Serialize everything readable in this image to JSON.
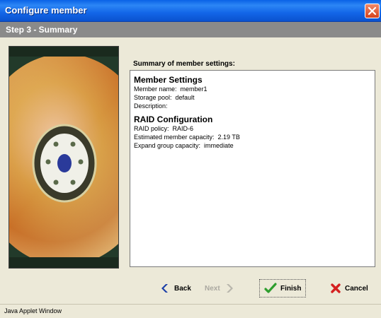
{
  "window": {
    "title": "Configure member"
  },
  "step": {
    "title": "Step 3 - Summary"
  },
  "summary": {
    "label": "Summary of member settings:",
    "member_settings": {
      "heading": "Member Settings",
      "rows": [
        "Member name:  member1",
        "Storage pool:  default",
        "Description:"
      ]
    },
    "raid": {
      "heading": "RAID Configuration",
      "rows": [
        "RAID policy:  RAID-6",
        "Estimated member capacity:  2.19 TB",
        "Expand group capacity:  immediate"
      ]
    }
  },
  "buttons": {
    "back": "Back",
    "next": "Next",
    "finish": "Finish",
    "cancel": "Cancel"
  },
  "status_bar": {
    "text": "Java Applet Window"
  },
  "icons": {
    "close": "close-icon",
    "back": "back-arrow-icon",
    "next": "next-arrow-icon",
    "finish": "checkmark-icon",
    "cancel": "cross-icon",
    "disk": "hard-disk-image"
  },
  "colors": {
    "title_bar": "#0a62e6",
    "step_bar": "#8a8a8a",
    "back_icon": "#1a3ea8",
    "finish_icon": "#2e9e2e",
    "cancel_icon": "#d42020"
  }
}
